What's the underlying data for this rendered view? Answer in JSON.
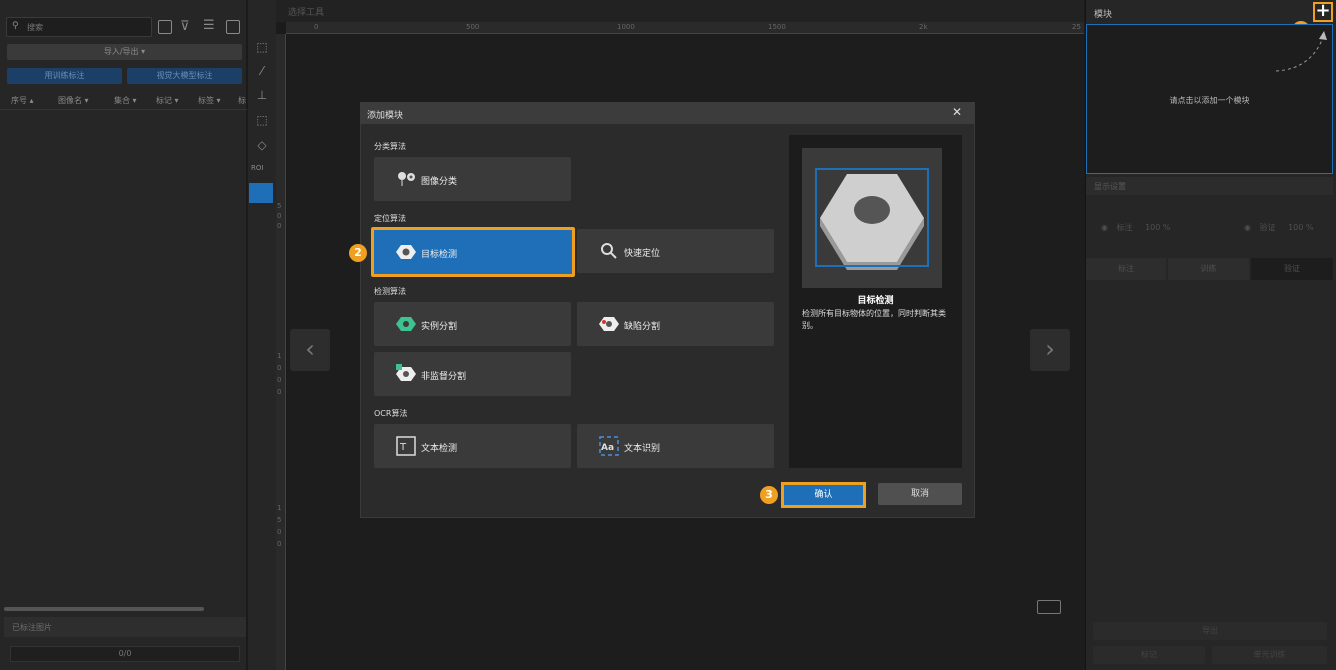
{
  "left_panel": {
    "search_placeholder": "搜索",
    "import_export": "导入/导出 ▾",
    "btn_train": "用训练标注",
    "btn_large_model": "视觉大模型标注",
    "columns": [
      "序号 ▴",
      "图像名 ▾",
      "集合 ▾",
      "标记 ▾",
      "标签 ▾",
      "标"
    ],
    "labeled_images": "已标注图片",
    "count": "0/0"
  },
  "toolstrip": {
    "roi_label": "ROI"
  },
  "canvas": {
    "tool_select": "选择工具",
    "ruler_top": [
      "0",
      "500",
      "1000",
      "1500",
      "2k",
      "25"
    ],
    "ruler_left": [
      "5",
      "0",
      "0",
      "1",
      "0",
      "0",
      "0",
      "1",
      "5",
      "0",
      "0"
    ]
  },
  "right_panel": {
    "title": "模块",
    "add_icon": "+",
    "empty_hint": "请点击以添加一个模块",
    "display_settings": "显示设置",
    "eye_annotate": "标注",
    "eye_annotate_pct": "100 %",
    "eye_verify": "验证",
    "eye_verify_pct": "100 %",
    "tabs": [
      "标注",
      "训练",
      "验证"
    ],
    "bottom": [
      "导出",
      "标记",
      "单元训练"
    ]
  },
  "dialog": {
    "title": "添加模块",
    "close": "✕",
    "sections": {
      "classification": "分类算法",
      "localization": "定位算法",
      "detection": "检测算法",
      "ocr": "OCR算法"
    },
    "cards": {
      "image_classification": "图像分类",
      "object_detection": "目标检测",
      "fast_positioning": "快速定位",
      "instance_segmentation": "实例分割",
      "defect_segmentation": "缺陷分割",
      "unsupervised_segmentation": "非监督分割",
      "text_detection": "文本检测",
      "text_recognition": "文本识别"
    },
    "preview": {
      "title": "目标检测",
      "description": "检测所有目标物体的位置，同时判断其类别。"
    },
    "confirm": "确认",
    "cancel": "取消"
  },
  "annotations": {
    "step1": "1",
    "step2": "2",
    "step3": "3"
  },
  "colors": {
    "accent": "#1e6fb8",
    "highlight": "#f0a020",
    "panel": "#262626",
    "card": "#3a3a3a"
  }
}
